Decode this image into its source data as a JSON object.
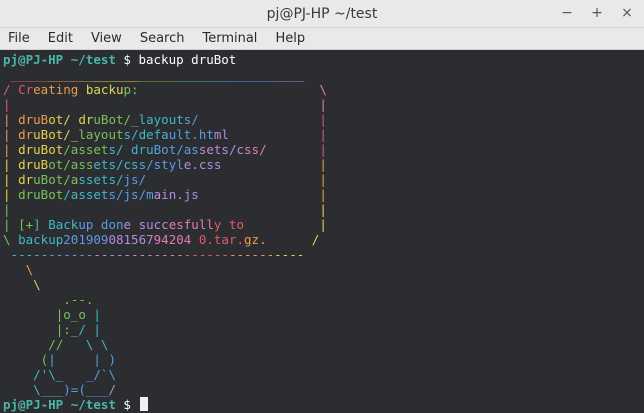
{
  "window": {
    "title": "pj@PJ-HP ~/test",
    "controls": {
      "minimize": "−",
      "maximize": "+",
      "close": "×"
    }
  },
  "menu": {
    "items": [
      "File",
      "Edit",
      "View",
      "Search",
      "Terminal",
      "Help"
    ]
  },
  "terminal": {
    "prompt_user": "pj@PJ-HP",
    "prompt_path": " ~/test",
    "prompt_symbol": " $ ",
    "first_command": "backup druBot",
    "box_lines": [
      " _______________________________________",
      "/ Creating backup:                        \\",
      "|                                         |",
      "| druBot/ druBot/_layouts/                |",
      "| druBot/_layouts/default.html            |",
      "| druBot/assets/ druBot/assets/css/       |",
      "| druBot/assets/css/style.css             |",
      "| druBot/assets/js/                       |",
      "| druBot/assets/js/main.js                |",
      "|                                         |",
      "| [+] Backup done succesfully to          |",
      "\\ backup20190908156794204 0.tar.gz.      /",
      " ---------------------------------------"
    ],
    "art_lines": [
      "   \\",
      "    \\",
      "        .--.",
      "       |o_o |",
      "       |:_/ |",
      "      //   \\ \\",
      "     (|     | )",
      "    /'\\_   _/`\\",
      "    \\___)=(___/"
    ],
    "final_prompt_user": "pj@PJ-HP",
    "final_prompt_path": " ~/test",
    "final_prompt_symbol": " $ "
  }
}
